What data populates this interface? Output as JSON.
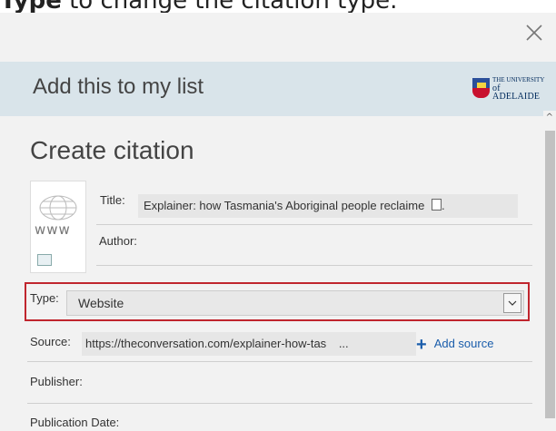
{
  "top_instruction": {
    "bold": "Type",
    "rest": " to change the citation type."
  },
  "dialog": {
    "header_title": "Add this to my list",
    "logo": {
      "line1": "THE UNIVERSITY",
      "line2": "of ADELAIDE"
    },
    "section_title": "Create citation"
  },
  "thumbnail": {
    "label": "www"
  },
  "fields": {
    "title_label": "Title:",
    "title_value": "Explainer: how Tasmania's Aboriginal people reclaime",
    "author_label": "Author:",
    "author_value": "",
    "type_label": "Type:",
    "type_value": "Website",
    "source_label": "Source:",
    "source_value": "https://theconversation.com/explainer-how-tas",
    "source_ellipsis": "...",
    "add_source_label": "Add source",
    "publisher_label": "Publisher:",
    "publication_date_label": "Publication Date:"
  },
  "colors": {
    "highlight": "#c0262e",
    "link": "#1a5dab",
    "header_bg": "#d9e4ea"
  }
}
